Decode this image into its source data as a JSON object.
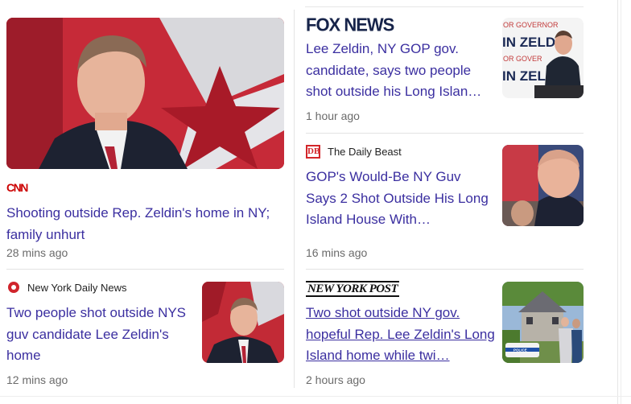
{
  "cards": [
    {
      "source": "CNN",
      "source_logo": "cnn-logo",
      "headline": "Shooting outside Rep. Zeldin's home in NY; family unhurt",
      "time": "28 mins ago"
    },
    {
      "source": "New York Daily News",
      "source_logo": "nydn-icon",
      "headline": "Two people shot outside NYS guv candidate Lee Zeldin's home",
      "time": "12 mins ago"
    },
    {
      "source": "FOX NEWS",
      "source_logo": "fox-news-logo",
      "headline": "Lee Zeldin, NY GOP gov. candidate, says two people shot outside his Long Islan…",
      "time": "1 hour ago"
    },
    {
      "source": "The Daily Beast",
      "source_logo": "daily-beast-icon",
      "icon_text": "DB",
      "headline": "GOP's Would-Be NY Guv Says 2 Shot Outside His Long Island House With…",
      "time": "16 mins ago"
    },
    {
      "source": "NEW YORK POST",
      "source_logo": "ny-post-logo",
      "headline": "Two shot outside NY gov. hopeful Rep. Lee Zeldin's Long Island home while twi…",
      "time": "2 hours ago"
    }
  ],
  "image_text": {
    "zeldin_sign": "IN ZELDIN",
    "governor_sign": "OR GOVERNOR",
    "police_car": "POLICE"
  },
  "colors": {
    "headline": "#3b2fa0",
    "time": "#6b6b6b",
    "cnn_red": "#cc0000",
    "fox_navy": "#17244a",
    "beast_red": "#d3262a"
  }
}
